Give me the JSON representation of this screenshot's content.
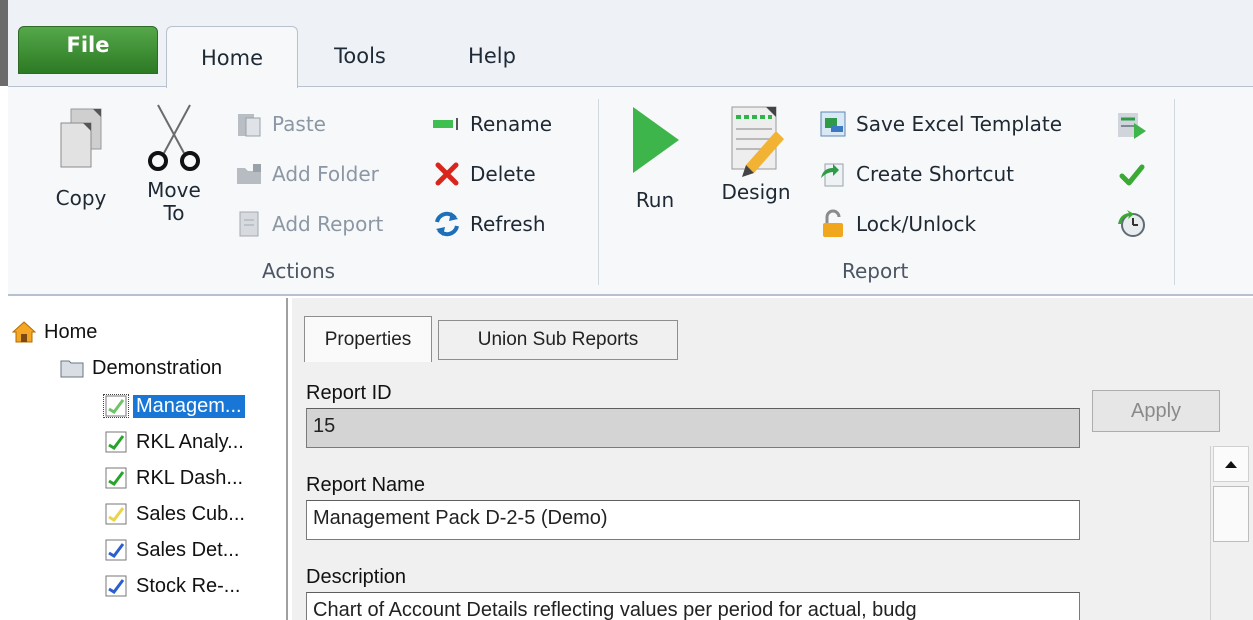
{
  "ribbon_tabs": {
    "file": "File",
    "home": "Home",
    "tools": "Tools",
    "help": "Help"
  },
  "actions_group": {
    "label": "Actions",
    "copy": "Copy",
    "move_line1": "Move",
    "move_line2": "To",
    "paste": "Paste",
    "add_folder": "Add Folder",
    "add_report": "Add Report",
    "rename": "Rename",
    "delete": "Delete",
    "refresh": "Refresh"
  },
  "report_group": {
    "label": "Report",
    "run": "Run",
    "design": "Design",
    "save_excel_template": "Save Excel Template",
    "create_shortcut": "Create Shortcut",
    "lock_unlock": "Lock/Unlock"
  },
  "tree": {
    "root": "Home",
    "folder": "Demonstration",
    "items": [
      {
        "label": "Managem...",
        "icon": "report-icon",
        "color": "#6fc46a",
        "selected": true
      },
      {
        "label": "RKL Analy...",
        "icon": "report-icon",
        "color": "#27a52a"
      },
      {
        "label": "RKL Dash...",
        "icon": "report-icon",
        "color": "#27a52a"
      },
      {
        "label": "Sales Cub...",
        "icon": "report-icon",
        "color": "#e8d44d"
      },
      {
        "label": "Sales Det...",
        "icon": "report-icon",
        "color": "#2b5fd0"
      },
      {
        "label": "Stock Re-...",
        "icon": "report-icon",
        "color": "#2b5fd0"
      }
    ]
  },
  "panel_tabs": {
    "properties": "Properties",
    "union": "Union Sub Reports"
  },
  "form": {
    "report_id_label": "Report ID",
    "report_id_value": "15",
    "report_name_label": "Report Name",
    "report_name_value": "Management Pack D-2-5 (Demo)",
    "description_label": "Description",
    "description_value": "Chart of Account Details reflecting values per period for actual, budg",
    "apply": "Apply"
  },
  "colors": {
    "file_tab": "#3d8f35",
    "selection": "#1877d6",
    "run_arrow": "#3db54a"
  }
}
